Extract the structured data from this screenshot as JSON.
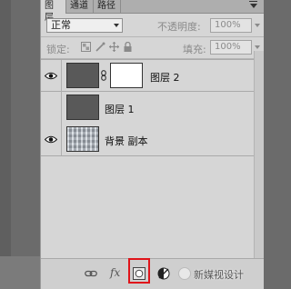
{
  "tabs": [
    {
      "label": "图层",
      "active": true
    },
    {
      "label": "通道",
      "active": false
    },
    {
      "label": "路径",
      "active": false
    }
  ],
  "blend_mode": {
    "value": "正常"
  },
  "opacity": {
    "label": "不透明度:",
    "value": "100%"
  },
  "lock": {
    "label": "锁定:"
  },
  "fill": {
    "label": "填充:",
    "value": "100%"
  },
  "layers": [
    {
      "name": "图层 2",
      "visible": true,
      "has_mask": true
    },
    {
      "name": "图层 1",
      "visible": false,
      "has_mask": false
    },
    {
      "name": "背景 副本",
      "visible": true,
      "has_mask": false
    }
  ],
  "bottom_toolbar": {
    "icons": [
      "link-layers-icon",
      "fx-icon",
      "add-mask-icon",
      "adjustment-layer-icon"
    ],
    "fx_label": "fx",
    "highlighted": "add-mask-icon"
  },
  "watermark": {
    "text": "新媒视设计"
  },
  "colors": {
    "highlight": "#e0141a",
    "panel_bg": "#d6d6d6"
  }
}
